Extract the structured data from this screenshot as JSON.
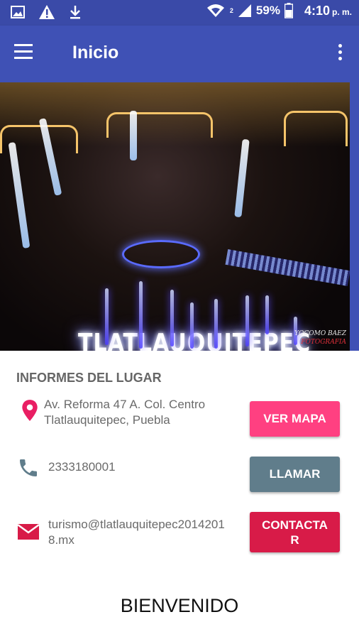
{
  "status_bar": {
    "battery": "59%",
    "time": "4:10",
    "ampm": "p. m.",
    "sim_label": "2"
  },
  "app_bar": {
    "title": "Inicio",
    "color": "#3f51b5"
  },
  "hero": {
    "sign_text": "TLATLAUQUITEPEC",
    "watermark_line1": "YOCOMO BAEZ",
    "watermark_line2": "FOTOGRAFIA"
  },
  "info": {
    "section_title": "INFORMES DEL LUGAR",
    "address_line1": "Av. Reforma 47 A. Col. Centro",
    "address_line2": "Tlatlauquitepec, Puebla",
    "phone": "2333180001",
    "email_line1": "turismo@tlatlauquitepec2014201",
    "email_line2": "8.mx"
  },
  "buttons": {
    "map_label": "VER MAPA",
    "call_label": "LLAMAR",
    "contact_line1": "CONTACTA",
    "contact_line2": "R"
  },
  "footer": {
    "welcome": "BIENVENIDO"
  },
  "colors": {
    "primary_dark": "#3a4aa8",
    "primary": "#3f51b5",
    "accent_pink": "#ff4081",
    "call_grey": "#607d8b",
    "contact_red": "#d81b48",
    "icon_pink": "#e91e63",
    "icon_grey": "#607d8b"
  },
  "icons": [
    "image-icon",
    "warning-icon",
    "download-icon",
    "wifi-icon",
    "signal-icon",
    "battery-icon",
    "menu-icon",
    "more-vert-icon",
    "location-pin-icon",
    "phone-icon",
    "email-icon"
  ]
}
